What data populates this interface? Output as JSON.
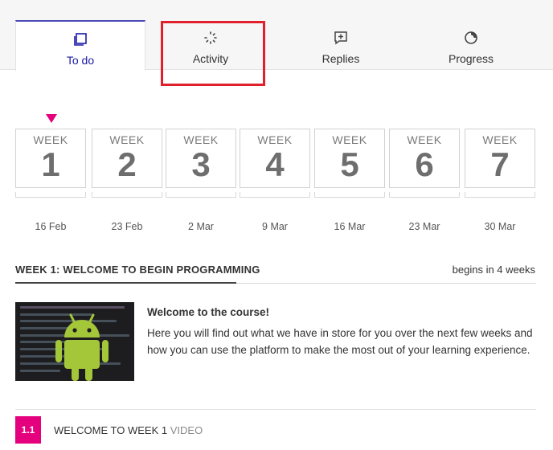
{
  "tabs": [
    {
      "label": "To do",
      "icon": "copy-icon",
      "active": true
    },
    {
      "label": "Activity",
      "icon": "activity-spinner-icon",
      "active": false
    },
    {
      "label": "Replies",
      "icon": "reply-add-icon",
      "active": false
    },
    {
      "label": "Progress",
      "icon": "progress-ring-icon",
      "active": false
    }
  ],
  "weeks": [
    {
      "label": "WEEK",
      "number": "1",
      "date": "16 Feb"
    },
    {
      "label": "WEEK",
      "number": "2",
      "date": "23 Feb"
    },
    {
      "label": "WEEK",
      "number": "3",
      "date": "2 Mar"
    },
    {
      "label": "WEEK",
      "number": "4",
      "date": "9 Mar"
    },
    {
      "label": "WEEK",
      "number": "5",
      "date": "16 Mar"
    },
    {
      "label": "WEEK",
      "number": "6",
      "date": "23 Mar"
    },
    {
      "label": "WEEK",
      "number": "7",
      "date": "30 Mar"
    }
  ],
  "section": {
    "title": "WEEK 1: WELCOME TO BEGIN PROGRAMMING",
    "begins": "begins in 4 weeks"
  },
  "intro": {
    "title": "Welcome to the course!",
    "text": "Here you will find out what we have in store for you over the next few weeks and how you can use the platform to make the most out of your learning experience."
  },
  "step": {
    "number": "1.1",
    "title": "WELCOME TO WEEK 1",
    "kind": "VIDEO"
  },
  "colors": {
    "accent": "#e5007e",
    "active_tab": "#1a1aa6",
    "highlight": "#e0202a",
    "android_green": "#a4c639"
  }
}
